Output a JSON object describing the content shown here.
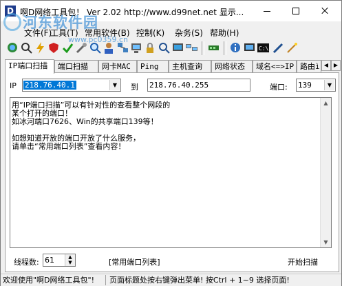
{
  "window": {
    "title": "啊D网络工具包！ Ver 2.02   http://www.d99net.net  显示..."
  },
  "watermark": {
    "title": "河东软件园",
    "url": "www.pc0359.cn"
  },
  "menu": [
    {
      "label": "文件(F)"
    },
    {
      "label": "工具(T)"
    },
    {
      "label": "常用软件(B)"
    },
    {
      "label": "控制(K)"
    },
    {
      "label": "杂务(S)"
    },
    {
      "label": "帮助(H)"
    }
  ],
  "tabs": [
    {
      "label": "IP端口扫描"
    },
    {
      "label": "端口扫描"
    },
    {
      "label": "网卡MAC"
    },
    {
      "label": "Ping"
    },
    {
      "label": "主机查询"
    },
    {
      "label": "网络状态"
    },
    {
      "label": "域名<=>IP"
    },
    {
      "label": "路由ì"
    }
  ],
  "scan": {
    "ip_label": "IP",
    "ip_from": "218.76.40.1",
    "to_label": "到",
    "ip_to": "218.76.40.255",
    "port_label": "端口:",
    "port_value": "139",
    "description_lines": [
      "用“IP端口扫描”可以有针对性的查看整个网段的",
      "某个打开的端口！",
      "如冰河端口7626、Win的共享端口139等！",
      "",
      "如想知道开放的端口开放了什么服务，",
      "请单击“常用端口列表”查看内容！"
    ],
    "threads_label": "线程数:",
    "threads_value": "61",
    "port_list_button": "[常用端口列表]",
    "start_button": "开始扫描"
  },
  "status": {
    "pane1": "欢迎使用\"啊D网络工具包\"!",
    "pane2": "页面标题处按右键弹出菜单! 按Ctrl + 1~9  选择页面!"
  },
  "colors": {
    "selection": "#0078d7",
    "watermark": "#3d8fd6"
  }
}
